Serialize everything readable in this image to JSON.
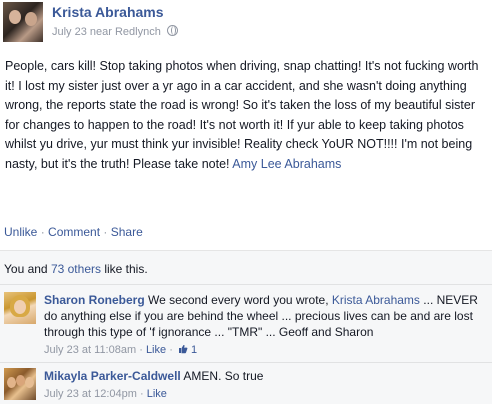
{
  "post": {
    "author": "Krista Abrahams",
    "meta": "July 23 near Redlynch",
    "text_before_link": "People, cars kill! Stop taking photos when driving, snap chatting! It's not fucking worth it! I lost my sister just over a yr ago in a car accident, and she wasn't doing anything wrong, the reports state the road is wrong! So it's taken the loss of my beautiful sister for changes to happen to the road! It's not worth it! If yur able to keep taking photos whilst yu drive, yur must think yur invisible! Reality check YoUR NOT!!!! I'm not being nasty, but it's the truth! Please take note! ",
    "tagged_name": "Amy Lee Abrahams"
  },
  "actions": {
    "unlike": "Unlike",
    "comment": "Comment",
    "share": "Share",
    "separator": " · "
  },
  "likes": {
    "prefix": "You and ",
    "others": "73 others",
    "suffix": " like this."
  },
  "comments": [
    {
      "author": "Sharon Roneberg",
      "text_before_mention": " We second every word you wrote, ",
      "mention": "Krista Abrahams",
      "text_after_mention": " ... NEVER do anything else if you are behind the wheel ... precious lives can be and are lost through this type of 'f ignorance ... \"TMR\" ... Geoff and Sharon",
      "timestamp": "July 23 at 11:08am",
      "like_label": "Like",
      "like_count": "1"
    },
    {
      "author": "Mikayla Parker-Caldwell",
      "text": " AMEN. So true",
      "timestamp": "July 23 at 12:04pm",
      "like_label": "Like"
    }
  ],
  "colors": {
    "link": "#3b5998",
    "meta": "#9197a3",
    "ufi_background": "#f6f7f8"
  },
  "icons": [
    "globe-icon",
    "thumbs-up-icon"
  ]
}
